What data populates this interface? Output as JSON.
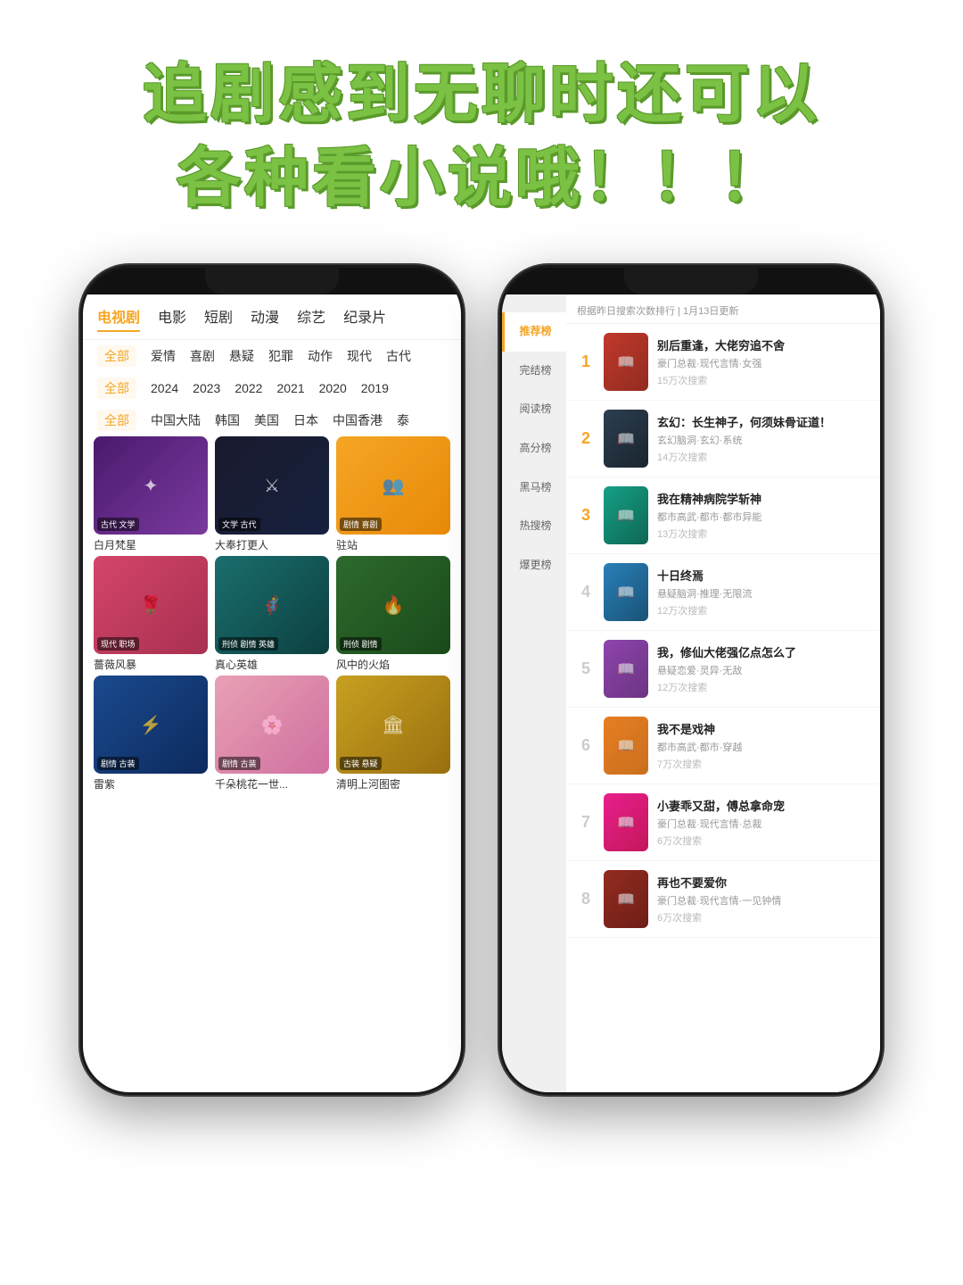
{
  "header": {
    "line1": "追剧感到无聊时还可以",
    "line2": "各种看小说哦！！！"
  },
  "left_phone": {
    "nav_tabs": [
      "电视剧",
      "电影",
      "短剧",
      "动漫",
      "综艺",
      "纪录片"
    ],
    "active_tab": "电视剧",
    "filter_rows": [
      {
        "items": [
          "全部",
          "爱情",
          "喜剧",
          "悬疑",
          "犯罪",
          "动作",
          "现代",
          "古代"
        ],
        "active": "全部"
      },
      {
        "items": [
          "全部",
          "2024",
          "2023",
          "2022",
          "2021",
          "2020",
          "2019"
        ],
        "active": "全部"
      },
      {
        "items": [
          "全部",
          "中国大陆",
          "韩国",
          "美国",
          "日本",
          "中国香港",
          "泰"
        ],
        "active": "全部"
      }
    ],
    "grid_rows": [
      {
        "items": [
          {
            "title": "白月梵星",
            "tag": "古代 文学",
            "color": "bg-purple"
          },
          {
            "title": "大奉打更人",
            "tag": "文学 古代",
            "color": "bg-dark"
          },
          {
            "title": "驻站",
            "tag": "剧情 喜剧",
            "color": "bg-yellow"
          }
        ]
      },
      {
        "items": [
          {
            "title": "薔薇风暴",
            "tag": "现代 职场",
            "color": "bg-rose"
          },
          {
            "title": "真心英雄",
            "tag": "刑侦 剧情 英雄",
            "color": "bg-teal"
          },
          {
            "title": "风中的火焰",
            "tag": "刑侦 剧情",
            "color": "bg-green"
          }
        ]
      },
      {
        "items": [
          {
            "title": "雷紫",
            "tag": "剧情 古装",
            "color": "bg-blue"
          },
          {
            "title": "千朵桃花一世...",
            "tag": "剧情 古装",
            "color": "bg-pink"
          },
          {
            "title": "清明上河图密",
            "tag": "古装 悬疑",
            "color": "bg-gold"
          }
        ]
      }
    ]
  },
  "right_phone": {
    "sidebar_items": [
      {
        "label": "推荐榜",
        "active": true
      },
      {
        "label": "完结榜",
        "active": false
      },
      {
        "label": "阅读榜",
        "active": false
      },
      {
        "label": "高分榜",
        "active": false
      },
      {
        "label": "黑马榜",
        "active": false
      },
      {
        "label": "热搜榜",
        "active": false
      },
      {
        "label": "爆更榜",
        "active": false
      }
    ],
    "rank_header": "根据昨日搜索次数排行 | 1月13日更新",
    "rank_items": [
      {
        "rank": "1",
        "title": "别后重逢，大佬穷追不舍",
        "tags": "豪门总裁·现代言情·女强",
        "count": "15万次搜索",
        "color": "book-red",
        "top": true
      },
      {
        "rank": "2",
        "title": "玄幻：长生神子，何须妹骨证道！",
        "tags": "玄幻脑洞·玄幻·系统",
        "count": "14万次搜索",
        "color": "book-dark",
        "top": true
      },
      {
        "rank": "3",
        "title": "我在精神病院学斩神",
        "tags": "都市高武·都市·都市异能",
        "count": "13万次搜索",
        "color": "book-teal",
        "top": true
      },
      {
        "rank": "4",
        "title": "十日终焉",
        "tags": "悬疑脑洞·推理·无限流",
        "count": "12万次搜索",
        "color": "book-slate",
        "top": false
      },
      {
        "rank": "5",
        "title": "我，修仙大佬强亿点怎么了",
        "tags": "悬疑恋爱·灵异·无敌",
        "count": "12万次搜索",
        "color": "book-purple",
        "top": false
      },
      {
        "rank": "6",
        "title": "我不是戏神",
        "tags": "都市高武·都市·穿越",
        "count": "7万次搜索",
        "color": "book-orange",
        "top": false
      },
      {
        "rank": "7",
        "title": "小妻乖又甜，傅总拿命宠",
        "tags": "豪门总裁·现代言情·总裁",
        "count": "6万次搜索",
        "color": "book-pink",
        "top": false
      },
      {
        "rank": "8",
        "title": "再也不要爱你",
        "tags": "豪门总裁·现代言情·一见钟情",
        "count": "6万次搜索",
        "color": "book-wine",
        "top": false
      }
    ]
  }
}
